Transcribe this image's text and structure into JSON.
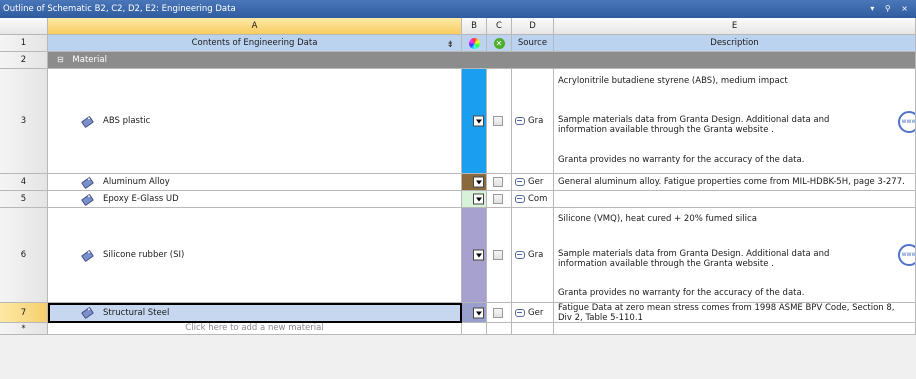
{
  "panel": {
    "title": "Outline of Schematic B2, C2, D2, E2: Engineering Data",
    "controls": "▾ ⚲ ×"
  },
  "columns": {
    "row_header": "",
    "A": "A",
    "B": "B",
    "C": "C",
    "D": "D",
    "E": "E"
  },
  "header_row": {
    "number": "1",
    "contents_label": "Contents of Engineering Data",
    "source_label": "Source",
    "description_label": "Description"
  },
  "category": {
    "number": "2",
    "expander": "⊟",
    "label": "Material"
  },
  "materials": [
    {
      "number": "3",
      "name": "ABS plastic",
      "color": "#1a9ff0",
      "source": "Gra",
      "description_lines": [
        "Acrylonitrile butadiene styrene (ABS), medium impact",
        "Sample materials data from Granta Design. Additional data and information available through the Granta website .",
        "Granta provides no warranty for the accuracy of the data."
      ]
    },
    {
      "number": "4",
      "name": "Aluminum Alloy",
      "color": "#8a6a3c",
      "source": "Ger",
      "description_lines": [
        "General aluminum alloy. Fatigue properties come from MIL-HDBK-5H, page 3-277."
      ]
    },
    {
      "number": "5",
      "name": "Epoxy E-Glass UD",
      "color": "#d9f0d9",
      "source": "Com",
      "description_lines": []
    },
    {
      "number": "6",
      "name": "Silicone rubber (SI)",
      "color": "#a7a1d0",
      "source": "Gra",
      "description_lines": [
        "Silicone (VMQ), heat cured + 20% fumed silica",
        "Sample materials data from Granta Design. Additional data and information available through the Granta website .",
        "Granta provides no warranty for the accuracy of the data."
      ]
    },
    {
      "number": "7",
      "name": "Structural Steel",
      "color": "#9aa0cc",
      "source": "Ger",
      "description_lines": [
        "Fatigue Data at zero mean stress comes from 1998 ASME BPV Code, Section 8, Div 2, Table 5-110.1"
      ]
    }
  ],
  "add_row": {
    "marker": "*",
    "placeholder": "Click here to add a new material"
  },
  "www_label": "www"
}
